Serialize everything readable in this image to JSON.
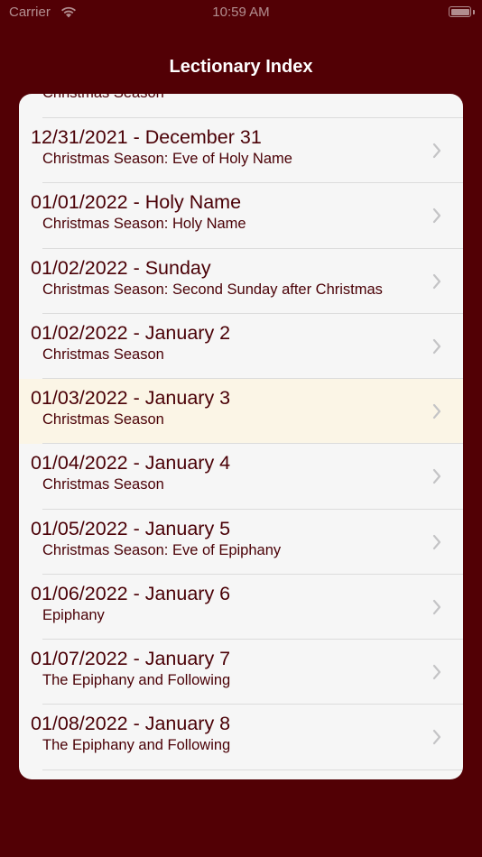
{
  "status_bar": {
    "carrier": "Carrier",
    "time": "10:59 AM",
    "wifi_icon": "wifi-icon",
    "battery_icon": "battery-icon"
  },
  "nav": {
    "title": "Lectionary Index"
  },
  "list": {
    "partial_top_subtitle": "Christmas Season",
    "items": [
      {
        "title": "12/31/2021 - December 31",
        "subtitle": "Christmas Season: Eve of Holy Name",
        "highlighted": false
      },
      {
        "title": "01/01/2022 - Holy Name",
        "subtitle": "Christmas Season: Holy Name",
        "highlighted": false
      },
      {
        "title": "01/02/2022 - Sunday",
        "subtitle": "Christmas Season: Second Sunday after Christmas",
        "highlighted": false
      },
      {
        "title": "01/02/2022 - January 2",
        "subtitle": "Christmas Season",
        "highlighted": false
      },
      {
        "title": "01/03/2022 - January 3",
        "subtitle": "Christmas Season",
        "highlighted": true
      },
      {
        "title": "01/04/2022 - January 4",
        "subtitle": "Christmas Season",
        "highlighted": false
      },
      {
        "title": "01/05/2022 - January 5",
        "subtitle": "Christmas Season: Eve of Epiphany",
        "highlighted": false
      },
      {
        "title": "01/06/2022 - January 6",
        "subtitle": "Epiphany",
        "highlighted": false
      },
      {
        "title": "01/07/2022 - January 7",
        "subtitle": "The Epiphany and Following",
        "highlighted": false
      },
      {
        "title": "01/08/2022 - January 8",
        "subtitle": "The Epiphany and Following",
        "highlighted": false
      }
    ]
  },
  "colors": {
    "background": "#520005",
    "card": "#f6f6f6",
    "text": "#4a0006",
    "highlight": "#fbf5e6",
    "chevron": "#c4c4c6"
  }
}
